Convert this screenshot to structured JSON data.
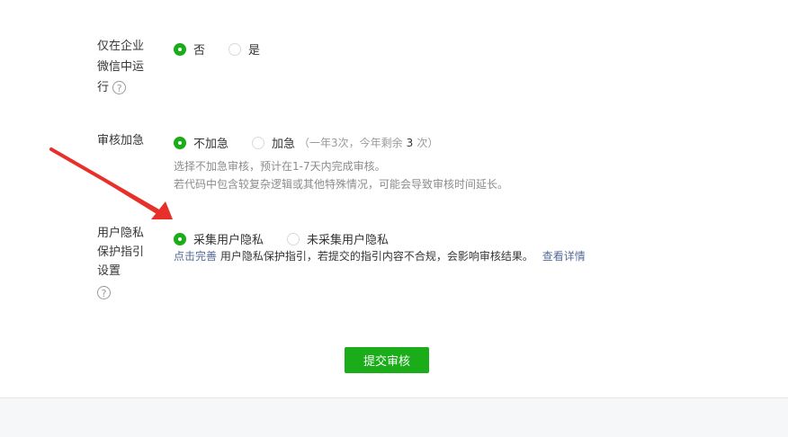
{
  "run_only_in_wework": {
    "label_lines": [
      "仅在企业",
      "微信中运",
      "行"
    ],
    "options": [
      {
        "label": "否",
        "checked": true
      },
      {
        "label": "是",
        "checked": false
      }
    ]
  },
  "review_urgent": {
    "label": "审核加急",
    "options": [
      {
        "label": "不加急",
        "checked": true
      },
      {
        "label": "加急",
        "checked": false
      }
    ],
    "urgent_extra_prefix": "（一年3次，今年剩余",
    "urgent_extra_count": "3",
    "urgent_extra_suffix": "次）",
    "desc_line1": "选择不加急审核，预计在1-7天内完成审核。",
    "desc_line2": "若代码中包含较复杂逻辑或其他特殊情况，可能会导致审核时间延长。"
  },
  "privacy_guide": {
    "label_lines": [
      "用户隐私",
      "保护指引",
      "设置"
    ],
    "options": [
      {
        "label": "采集用户隐私",
        "checked": true
      },
      {
        "label": "未采集用户隐私",
        "checked": false
      }
    ],
    "complete_link": "点击完善",
    "desc_text": "用户隐私保护指引，若提交的指引内容不合规，会影响审核结果。",
    "details_link": "查看详情"
  },
  "help_icon_glyph": "?",
  "submit_label": "提交审核",
  "colors": {
    "accent": "#1aad19",
    "link": "#576b95",
    "arrow": "#e8302a"
  },
  "icons": {
    "help": "question-circle-icon",
    "annotation": "red-arrow"
  }
}
